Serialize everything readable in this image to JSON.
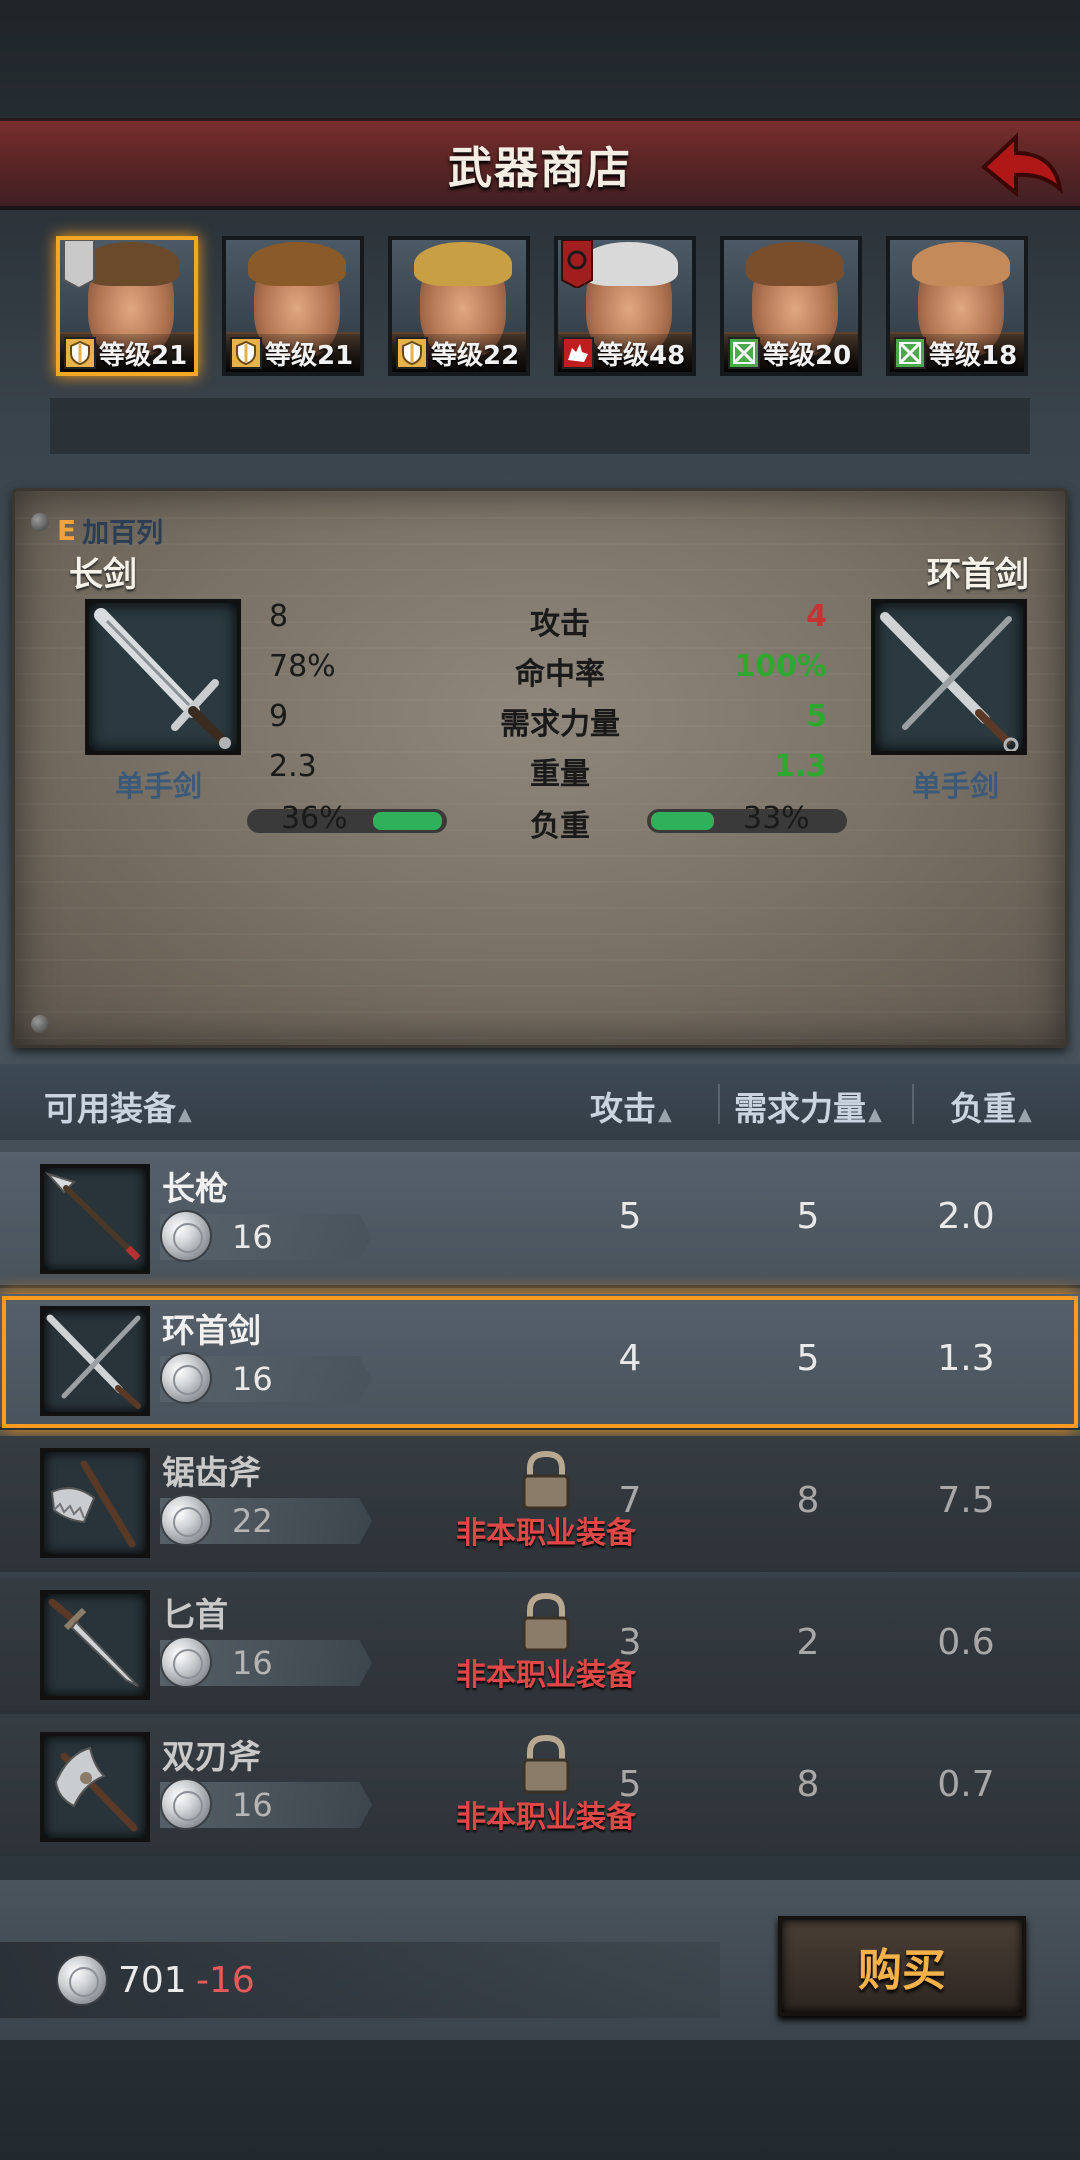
{
  "header": {
    "title": "武器商店"
  },
  "heroes": [
    {
      "level_text": "等级21",
      "class": "shield",
      "selected": true,
      "hair": "#6b4a2c"
    },
    {
      "level_text": "等级21",
      "class": "shield",
      "selected": false,
      "hair": "#8a5a28"
    },
    {
      "level_text": "等级22",
      "class": "shield",
      "selected": false,
      "hair": "#c8a043"
    },
    {
      "level_text": "等级48",
      "class": "wolf",
      "selected": false,
      "hair": "#d9d9d9"
    },
    {
      "level_text": "等级20",
      "class": "green-x",
      "selected": false,
      "hair": "#7a4e2a"
    },
    {
      "level_text": "等级18",
      "class": "green-x",
      "selected": false,
      "hair": "#c48a5a"
    }
  ],
  "compare": {
    "hero_prefix": "E",
    "hero_name": "加百列",
    "current": {
      "name": "长剑",
      "type": "单手剑"
    },
    "candidate": {
      "name": "环首剑",
      "type": "单手剑"
    },
    "stats": [
      {
        "label": "攻击",
        "left": "8",
        "right": "4",
        "right_color": "red"
      },
      {
        "label": "命中率",
        "left": "78%",
        "right": "100%",
        "right_color": "green"
      },
      {
        "label": "需求力量",
        "left": "9",
        "right": "5",
        "right_color": "green"
      },
      {
        "label": "重量",
        "left": "2.3",
        "right": "1.3",
        "right_color": "green"
      }
    ],
    "load": {
      "label": "负重",
      "left": "36%",
      "right": "33%",
      "left_fraction": 0.36,
      "right_fraction": 0.33
    }
  },
  "list_header": {
    "available": "可用装备",
    "attack": "攻击",
    "strength": "需求力量",
    "weight": "负重"
  },
  "items": [
    {
      "name": "长枪",
      "price": "16",
      "attack": "5",
      "strength": "5",
      "weight": "2.0",
      "locked": false,
      "selected": false
    },
    {
      "name": "环首剑",
      "price": "16",
      "attack": "4",
      "strength": "5",
      "weight": "1.3",
      "locked": false,
      "selected": true
    },
    {
      "name": "锯齿斧",
      "price": "22",
      "attack": "7",
      "strength": "8",
      "weight": "7.5",
      "locked": true,
      "selected": false
    },
    {
      "name": "匕首",
      "price": "16",
      "attack": "3",
      "strength": "2",
      "weight": "0.6",
      "locked": true,
      "selected": false
    },
    {
      "name": "双刃斧",
      "price": "16",
      "attack": "5",
      "strength": "8",
      "weight": "0.7",
      "locked": true,
      "selected": false
    }
  ],
  "locked_text": "非本职业装备",
  "footer": {
    "money": "701",
    "delta": "-16",
    "buy_label": "购买"
  },
  "colors": {
    "accent": "#ff9a1e",
    "header_red": "#7a2e2e",
    "buy_text": "#f6b24a"
  }
}
